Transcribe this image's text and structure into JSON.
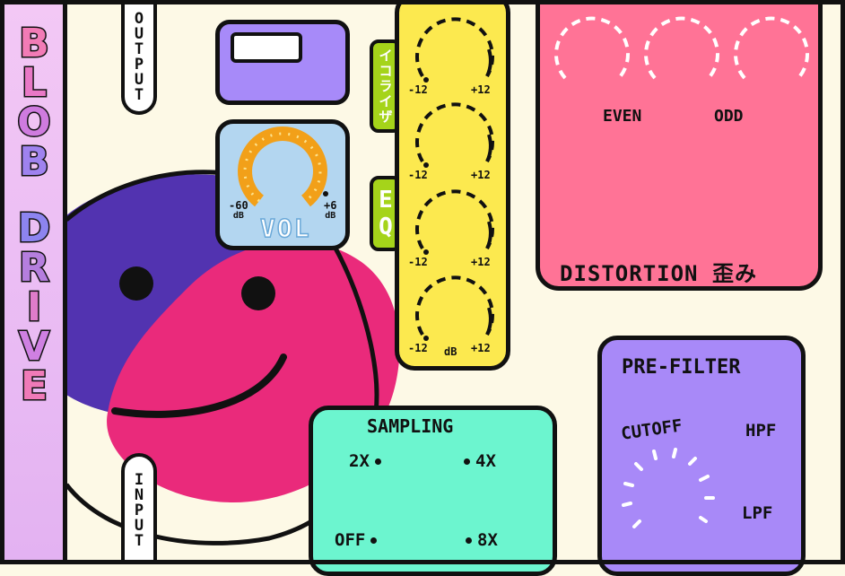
{
  "app": {
    "title_letters": [
      "B",
      "L",
      "O",
      "B",
      "D",
      "R",
      "I",
      "V",
      "E"
    ]
  },
  "output": {
    "label_letters": [
      "O",
      "U",
      "T",
      "P",
      "U",
      "T"
    ]
  },
  "input": {
    "label_letters": [
      "I",
      "N",
      "P",
      "U",
      "T"
    ]
  },
  "volume": {
    "label": "VOL",
    "min": "-60",
    "max": "+6",
    "unit": "dB"
  },
  "eq": {
    "tag_jp": [
      "イ",
      "コ",
      "ラ",
      "イ",
      "ザ"
    ],
    "tag_en": [
      "E",
      "Q"
    ],
    "bands": [
      {
        "min": "-12",
        "max": "+12"
      },
      {
        "min": "-12",
        "max": "+12"
      },
      {
        "min": "-12",
        "max": "+12"
      },
      {
        "min": "-12",
        "max": "+12",
        "unit": "dB"
      }
    ]
  },
  "distortion": {
    "title": "DISTORTION 歪み",
    "even_label": "EVEN",
    "odd_label": "ODD"
  },
  "sampling": {
    "title": "SAMPLING",
    "options": {
      "x2": "2X",
      "x4": "4X",
      "off": "OFF",
      "x8": "8X"
    }
  },
  "prefilter": {
    "title": "PRE-FILTER",
    "cutoff_label": "CUTOFF",
    "hpf_label": "HPF",
    "lpf_label": "LPF"
  },
  "colors": {
    "background": "#fdf9e6",
    "title_strip": "#f3c8f5",
    "volume_panel": "#b3d6f0",
    "volume_arc": "#f2a019",
    "eq_panel": "#fce94f",
    "eq_tag": "#a5d41a",
    "distortion_panel": "#ff7396",
    "sampling_panel": "#6cf5cf",
    "prefilter_panel": "#a889f8",
    "output_box": "#a78af9",
    "blob_purple": "#5233b0",
    "blob_pink": "#ea2a7b"
  }
}
